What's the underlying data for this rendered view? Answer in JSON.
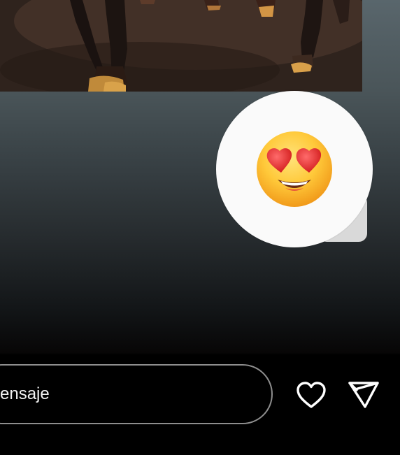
{
  "story": {
    "image_icon": "horse-legs-photo"
  },
  "reaction": {
    "emoji": "😍",
    "emoji_name": "heart-eyes-icon"
  },
  "reply_bar": {
    "placeholder": "ensaje",
    "like_icon": "heart-outline-icon",
    "send_icon": "paper-plane-icon"
  },
  "colors": {
    "background_top": "#59666c",
    "background_bottom": "#000000",
    "bubble": "#fafafa",
    "card": "#d9d9d9",
    "input_border": "#8e8e8e",
    "icon_white": "#ffffff"
  }
}
